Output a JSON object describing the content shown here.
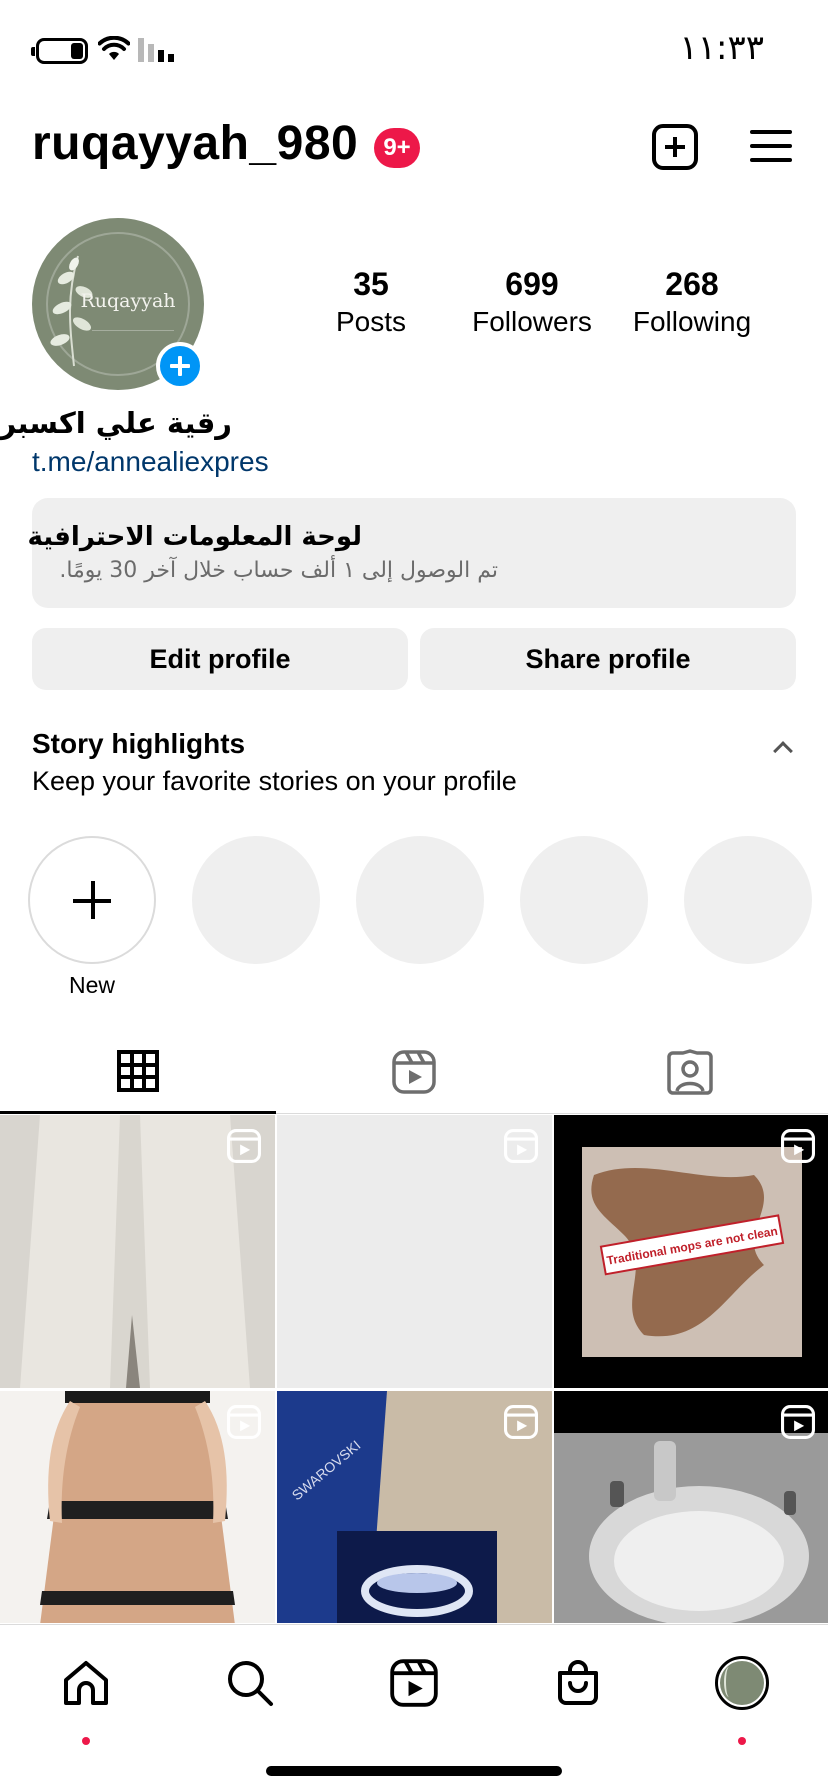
{
  "status_bar": {
    "time": "١١:٣٣",
    "battery_level": 0.25,
    "icons": [
      "battery-icon",
      "wifi-icon",
      "cellular-signal-icon"
    ]
  },
  "header": {
    "username": "ruqayyah_980",
    "notification_badge": "9+",
    "icons": [
      "new-post-icon",
      "menu-icon"
    ]
  },
  "profile": {
    "avatar_text": "Ruqayyah",
    "full_name": "رقية علي اكسبرس",
    "link": "t.me/annealiexpres",
    "stats": {
      "posts": {
        "value": "35",
        "label": "Posts"
      },
      "followers": {
        "value": "699",
        "label": "Followers"
      },
      "following": {
        "value": "268",
        "label": "Following"
      }
    }
  },
  "professional_dashboard": {
    "title": "لوحة المعلومات الاحترافية",
    "subtitle": "تم الوصول إلى ١ ألف حساب خلال آخر 30 يومًا."
  },
  "buttons": {
    "edit_profile": "Edit profile",
    "share_profile": "Share profile"
  },
  "highlights": {
    "title": "Story highlights",
    "subtitle": "Keep your favorite stories on your profile",
    "new_label": "New",
    "empty_slots": 4
  },
  "tabs": [
    "grid-icon",
    "reels-icon",
    "tagged-icon"
  ],
  "grid": {
    "overlay_text_post3": "Traditional mops are not clean",
    "overlay_text_post5": "SWAROVSKI"
  },
  "bottom_nav": [
    "home-icon",
    "search-icon",
    "reels-icon",
    "shop-icon",
    "profile-avatar"
  ],
  "colors": {
    "accent_blue": "#0095f6",
    "badge_red": "#ed1849",
    "link_blue": "#00376b",
    "button_gray": "#efefef"
  }
}
